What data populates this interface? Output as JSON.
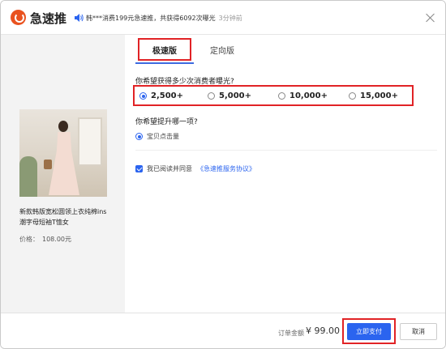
{
  "header": {
    "app_title": "急速推",
    "ticker_text": "韩***消费199元急速推，共获得6092次曝光",
    "ticker_time": "3分钟前",
    "close_icon": "close-icon",
    "speaker_icon": "speaker-icon"
  },
  "product": {
    "title": "新款韩版宽松圆领上衣纯棉ins潮字母短袖T恤女",
    "price_label": "价格：",
    "price_value": "108.00元"
  },
  "tabs": [
    {
      "label": "极速版",
      "active": true
    },
    {
      "label": "定向版",
      "active": false
    }
  ],
  "question_exposure": "你希望获得多少次消费者曝光?",
  "exposure_options": [
    {
      "label": "2,500+",
      "selected": true
    },
    {
      "label": "5,000+",
      "selected": false
    },
    {
      "label": "10,000+",
      "selected": false
    },
    {
      "label": "15,000+",
      "selected": false
    }
  ],
  "question_goal": "你希望提升哪一项?",
  "goal_option": {
    "label": "宝贝点击量",
    "selected": true
  },
  "agreement": {
    "text": "我已阅读并同意",
    "link": "《急速推服务协议》",
    "checked": true
  },
  "footer": {
    "total_label": "订单金额",
    "total_value": "¥ 99.00",
    "pay_label": "立即支付",
    "cancel_label": "取消"
  },
  "colors": {
    "accent": "#2b64ef",
    "highlight": "#e12326",
    "brand": "#e9521f"
  }
}
